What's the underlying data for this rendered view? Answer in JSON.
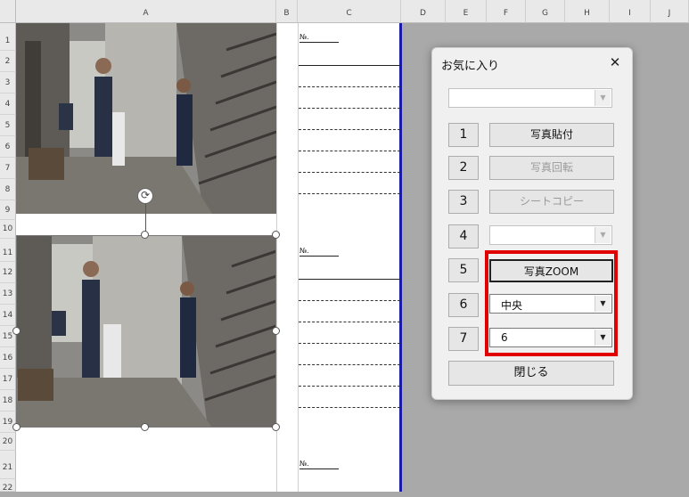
{
  "sheet": {
    "columns": [
      "A",
      "B",
      "C",
      "D",
      "E",
      "F",
      "G",
      "H",
      "I",
      "J"
    ],
    "rows": [
      "1",
      "2",
      "3",
      "4",
      "5",
      "6",
      "7",
      "8",
      "9",
      "10",
      "11",
      "12",
      "13",
      "14",
      "15",
      "16",
      "17",
      "18",
      "19",
      "20",
      "21",
      "22"
    ],
    "no_labels": [
      "№.",
      "№.",
      "№."
    ]
  },
  "dialog": {
    "title": "お気に入り",
    "close_glyph": "✕",
    "top_combo_value": "",
    "num_buttons": [
      "1",
      "2",
      "3",
      "4",
      "5",
      "6",
      "7"
    ],
    "paste_photo": "写真貼付",
    "rotate_photo": "写真回転",
    "sheet_copy": "シートコピー",
    "row4_combo_value": "",
    "zoom": "写真ZOOM",
    "position_value": "中央",
    "zoom_level_value": "6",
    "close_button": "閉じる"
  },
  "colors": {
    "highlight": "#e00000",
    "column_border": "#1a1aa8"
  }
}
